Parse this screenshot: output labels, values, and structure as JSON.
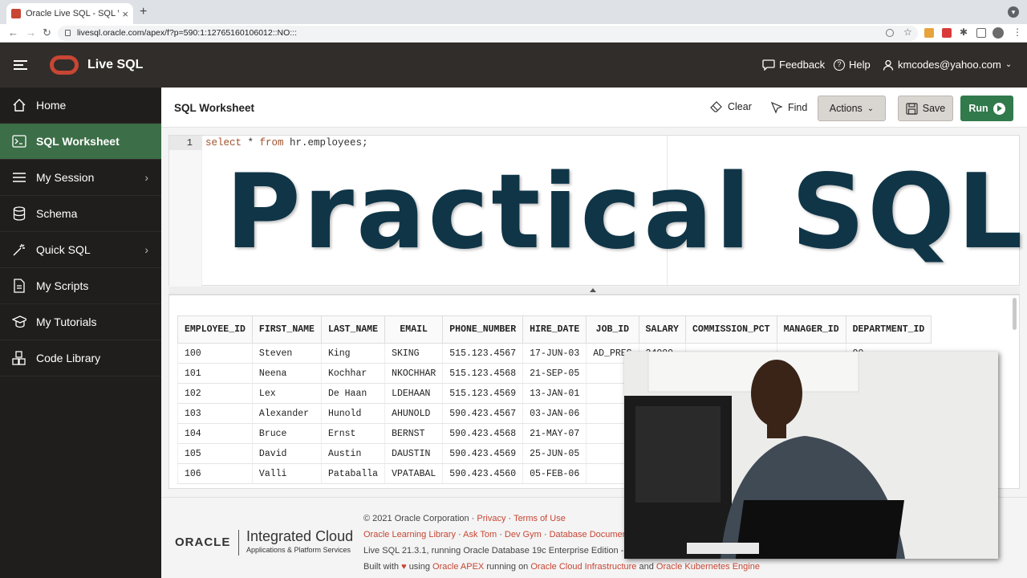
{
  "browser": {
    "tab_title": "Oracle Live SQL - SQL Worksh",
    "tab_close": "×",
    "new_tab": "+",
    "url": "livesql.oracle.com/apex/f?p=590:1:12765160106012::NO:::",
    "nav": {
      "back": "←",
      "forward": "→",
      "reload": "↻"
    }
  },
  "header": {
    "app_name": "Live SQL",
    "feedback": "Feedback",
    "help": "Help",
    "user": "kmcodes@yahoo.com"
  },
  "sidebar": {
    "items": [
      {
        "label": "Home",
        "icon": "home-icon"
      },
      {
        "label": "SQL Worksheet",
        "icon": "terminal-icon",
        "active": true
      },
      {
        "label": "My Session",
        "icon": "list-icon",
        "chevron": true
      },
      {
        "label": "Schema",
        "icon": "database-icon"
      },
      {
        "label": "Quick SQL",
        "icon": "magic-wand-icon",
        "chevron": true
      },
      {
        "label": "My Scripts",
        "icon": "document-icon"
      },
      {
        "label": "My Tutorials",
        "icon": "graduation-cap-icon"
      },
      {
        "label": "Code Library",
        "icon": "blocks-icon"
      }
    ]
  },
  "worksheet": {
    "title": "SQL Worksheet",
    "clear": "Clear",
    "find": "Find",
    "actions": "Actions",
    "save": "Save",
    "run": "Run",
    "line_number": "1",
    "code_kw1": "select",
    "code_mid": " * ",
    "code_kw2": "from",
    "code_rest": " hr.employees;"
  },
  "overlay_title": "Practical SQL",
  "results": {
    "columns": [
      "EMPLOYEE_ID",
      "FIRST_NAME",
      "LAST_NAME",
      "EMAIL",
      "PHONE_NUMBER",
      "HIRE_DATE",
      "JOB_ID",
      "SALARY",
      "COMMISSION_PCT",
      "MANAGER_ID",
      "DEPARTMENT_ID"
    ],
    "rows": [
      [
        "100",
        "Steven",
        "King",
        "SKING",
        "515.123.4567",
        "17-JUN-03",
        "AD_PRES",
        "24000",
        "-",
        "-",
        "90"
      ],
      [
        "101",
        "Neena",
        "Kochhar",
        "NKOCHHAR",
        "515.123.4568",
        "21-SEP-05",
        "",
        "",
        "",
        "",
        ""
      ],
      [
        "102",
        "Lex",
        "De Haan",
        "LDEHAAN",
        "515.123.4569",
        "13-JAN-01",
        "",
        "",
        "",
        "",
        ""
      ],
      [
        "103",
        "Alexander",
        "Hunold",
        "AHUNOLD",
        "590.423.4567",
        "03-JAN-06",
        "",
        "",
        "",
        "",
        ""
      ],
      [
        "104",
        "Bruce",
        "Ernst",
        "BERNST",
        "590.423.4568",
        "21-MAY-07",
        "",
        "",
        "",
        "",
        ""
      ],
      [
        "105",
        "David",
        "Austin",
        "DAUSTIN",
        "590.423.4569",
        "25-JUN-05",
        "",
        "",
        "",
        "",
        ""
      ],
      [
        "106",
        "Valli",
        "Pataballa",
        "VPATABAL",
        "590.423.4560",
        "05-FEB-06",
        "",
        "",
        "",
        "",
        ""
      ]
    ]
  },
  "footer": {
    "oracle": "ORACLE",
    "ic_title": "Integrated Cloud",
    "ic_sub": "Applications & Platform Services",
    "copyright": "© 2021 Oracle Corporation ·",
    "privacy": "Privacy",
    "terms": "Terms of Use",
    "sep": "·",
    "learning": "Oracle Learning Library",
    "asktom": "Ask Tom",
    "devgym": "Dev Gym",
    "docs": "Database Documen",
    "version": "Live SQL 21.3.1, running Oracle Database 19c Enterprise Edition - 1",
    "built1": "Built with",
    "built2": "using",
    "apex": "Oracle APEX",
    "built3": "running on",
    "oci": "Oracle Cloud Infrastructure",
    "built4": "and",
    "oke": "Oracle Kubernetes Engine"
  },
  "colors": {
    "brand_red": "#c74634",
    "active_green": "#3c6e47",
    "run_green": "#317a4b",
    "title_navy": "#0f3547"
  }
}
